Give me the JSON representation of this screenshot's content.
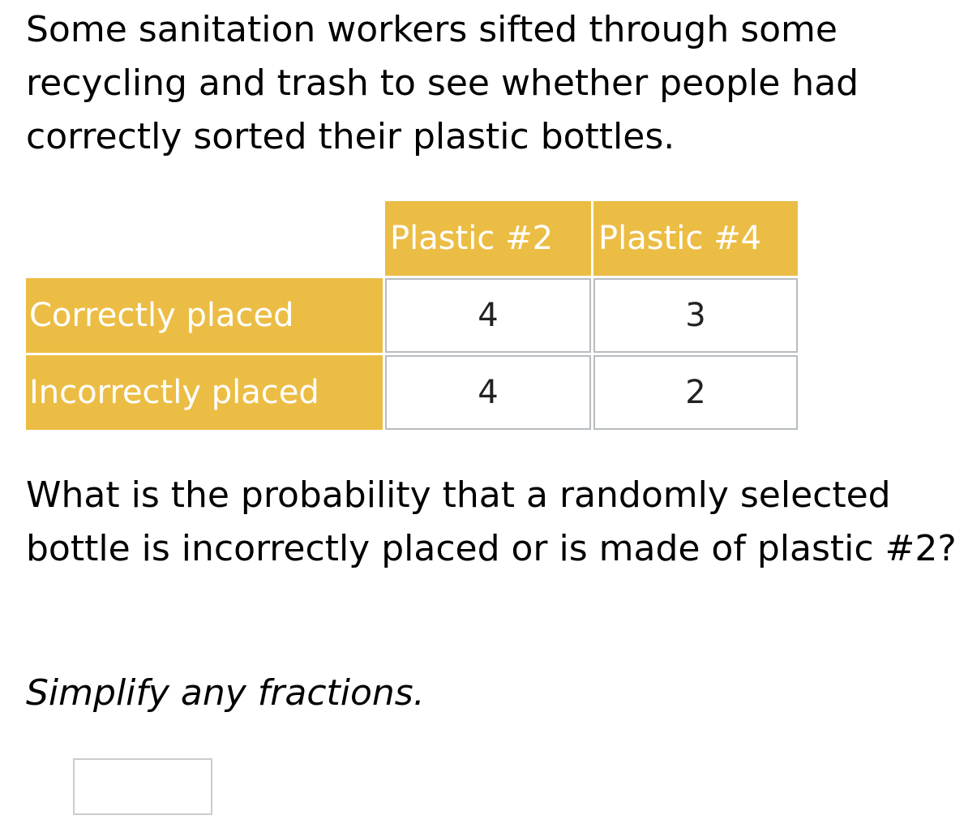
{
  "problem": {
    "intro": "Some sanitation workers sifted through some recycling and trash to see whether people had correctly sorted their plastic bottles.",
    "table": {
      "columns": [
        "Plastic #2",
        "Plastic #4"
      ],
      "rows": [
        {
          "label": "Correctly placed",
          "values": [
            "4",
            "3"
          ]
        },
        {
          "label": "Incorrectly placed",
          "values": [
            "4",
            "2"
          ]
        }
      ]
    },
    "question": "What is the probability that a randomly selected bottle is incorrectly placed or is made of plastic #2?",
    "instruction": "Simplify any fractions.",
    "answer": {
      "value": "",
      "placeholder": ""
    }
  },
  "colors": {
    "header_fill": "#ecbd45",
    "header_text": "#ffffff",
    "cell_border": "#b7bcc0",
    "input_border": "#cccccc"
  }
}
